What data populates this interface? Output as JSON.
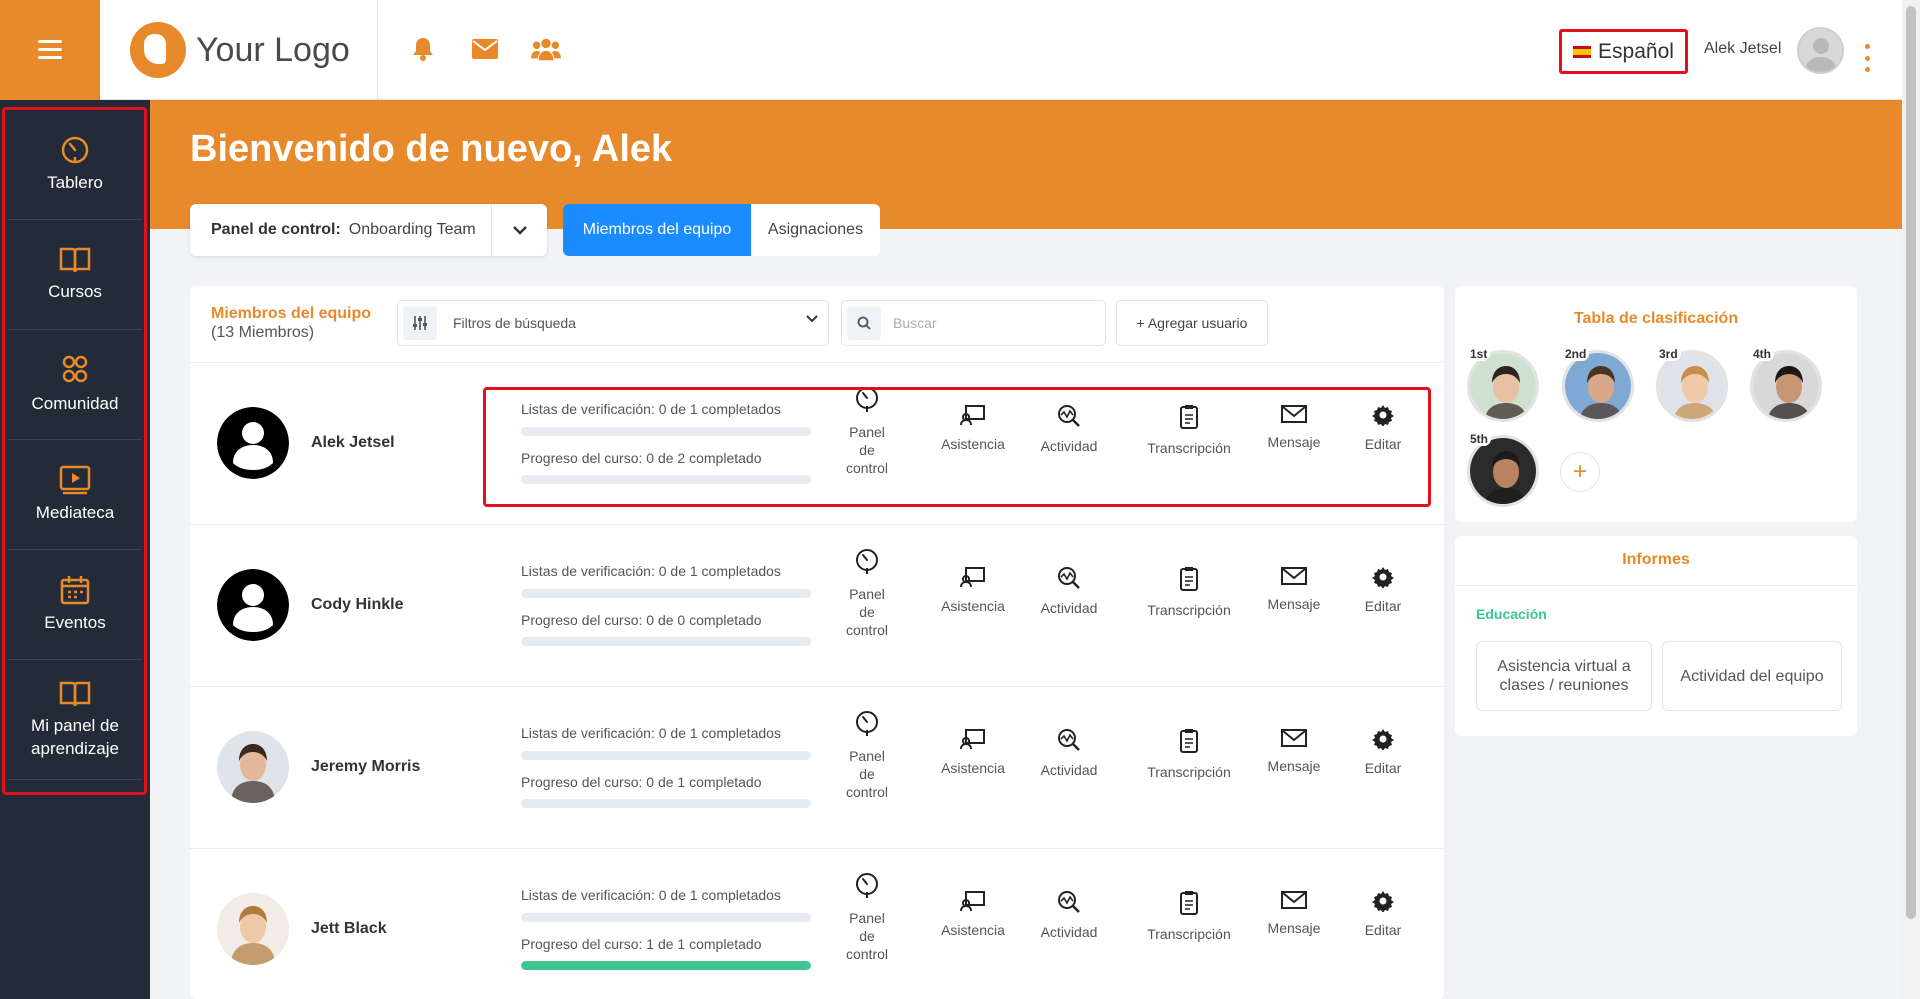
{
  "header": {
    "logo_text": "Your Logo",
    "language": "Español",
    "user_name": "Alek Jetsel",
    "icons": [
      "bell-icon",
      "envelope-icon",
      "users-icon"
    ],
    "accent_color": "#e8892c"
  },
  "sidebar": {
    "items": [
      {
        "label": "Tablero",
        "icon": "dashboard-gauge-icon"
      },
      {
        "label": "Cursos",
        "icon": "book-icon"
      },
      {
        "label": "Comunidad",
        "icon": "community-icon"
      },
      {
        "label": "Mediateca",
        "icon": "media-library-icon"
      },
      {
        "label": "Eventos",
        "icon": "calendar-icon"
      },
      {
        "label": "Mi panel de aprendizaje",
        "icon": "book-icon"
      }
    ]
  },
  "banner": {
    "welcome": "Bienvenido de nuevo, Alek",
    "panel_label": "Panel de control:",
    "panel_value": "Onboarding Team",
    "tabs": [
      {
        "label": "Miembros del equipo",
        "active": true
      },
      {
        "label": "Asignaciones",
        "active": false
      }
    ]
  },
  "members": {
    "title": "Miembros del equipo",
    "count": "(13 Miembros)",
    "filter_label": "Filtros de búsqueda",
    "search_placeholder": "Buscar",
    "add_user": "+ Agregar usuario",
    "actions": {
      "panel": [
        "Panel",
        "de",
        "control"
      ],
      "attendance": "Asistencia",
      "activity": "Actividad",
      "transcript": "Transcripción",
      "message": "Mensaje",
      "edit": "Editar"
    },
    "rows": [
      {
        "name": "Alek Jetsel",
        "checklists": "Listas de verificación: 0 de 1 completados",
        "checklist_fraction": 0,
        "progress": "Progreso del curso: 0 de 2 completado",
        "progress_fraction": 0,
        "avatar": "default"
      },
      {
        "name": "Cody Hinkle",
        "checklists": "Listas de verificación: 0 de 1 completados",
        "checklist_fraction": 0,
        "progress": "Progreso del curso: 0 de 0 completado",
        "progress_fraction": 0,
        "avatar": "default"
      },
      {
        "name": "Jeremy Morris",
        "checklists": "Listas de verificación: 0 de 1 completados",
        "checklist_fraction": 0,
        "progress": "Progreso del curso: 0 de 1 completado",
        "progress_fraction": 0,
        "avatar": "photo"
      },
      {
        "name": "Jett Black",
        "checklists": "Listas de verificación: 0 de 1 completados",
        "checklist_fraction": 0,
        "progress": "Progreso del curso: 1 de 1 completado",
        "progress_fraction": 1,
        "avatar": "photo"
      }
    ]
  },
  "leaderboard": {
    "title": "Tabla de clasificación",
    "ranks": [
      "1st",
      "2nd",
      "3rd",
      "4th",
      "5th"
    ],
    "add": "+"
  },
  "reports": {
    "title": "Informes",
    "section": "Educación",
    "buttons": [
      "Asistencia virtual a clases / reuniones",
      "Actividad del equipo"
    ]
  }
}
